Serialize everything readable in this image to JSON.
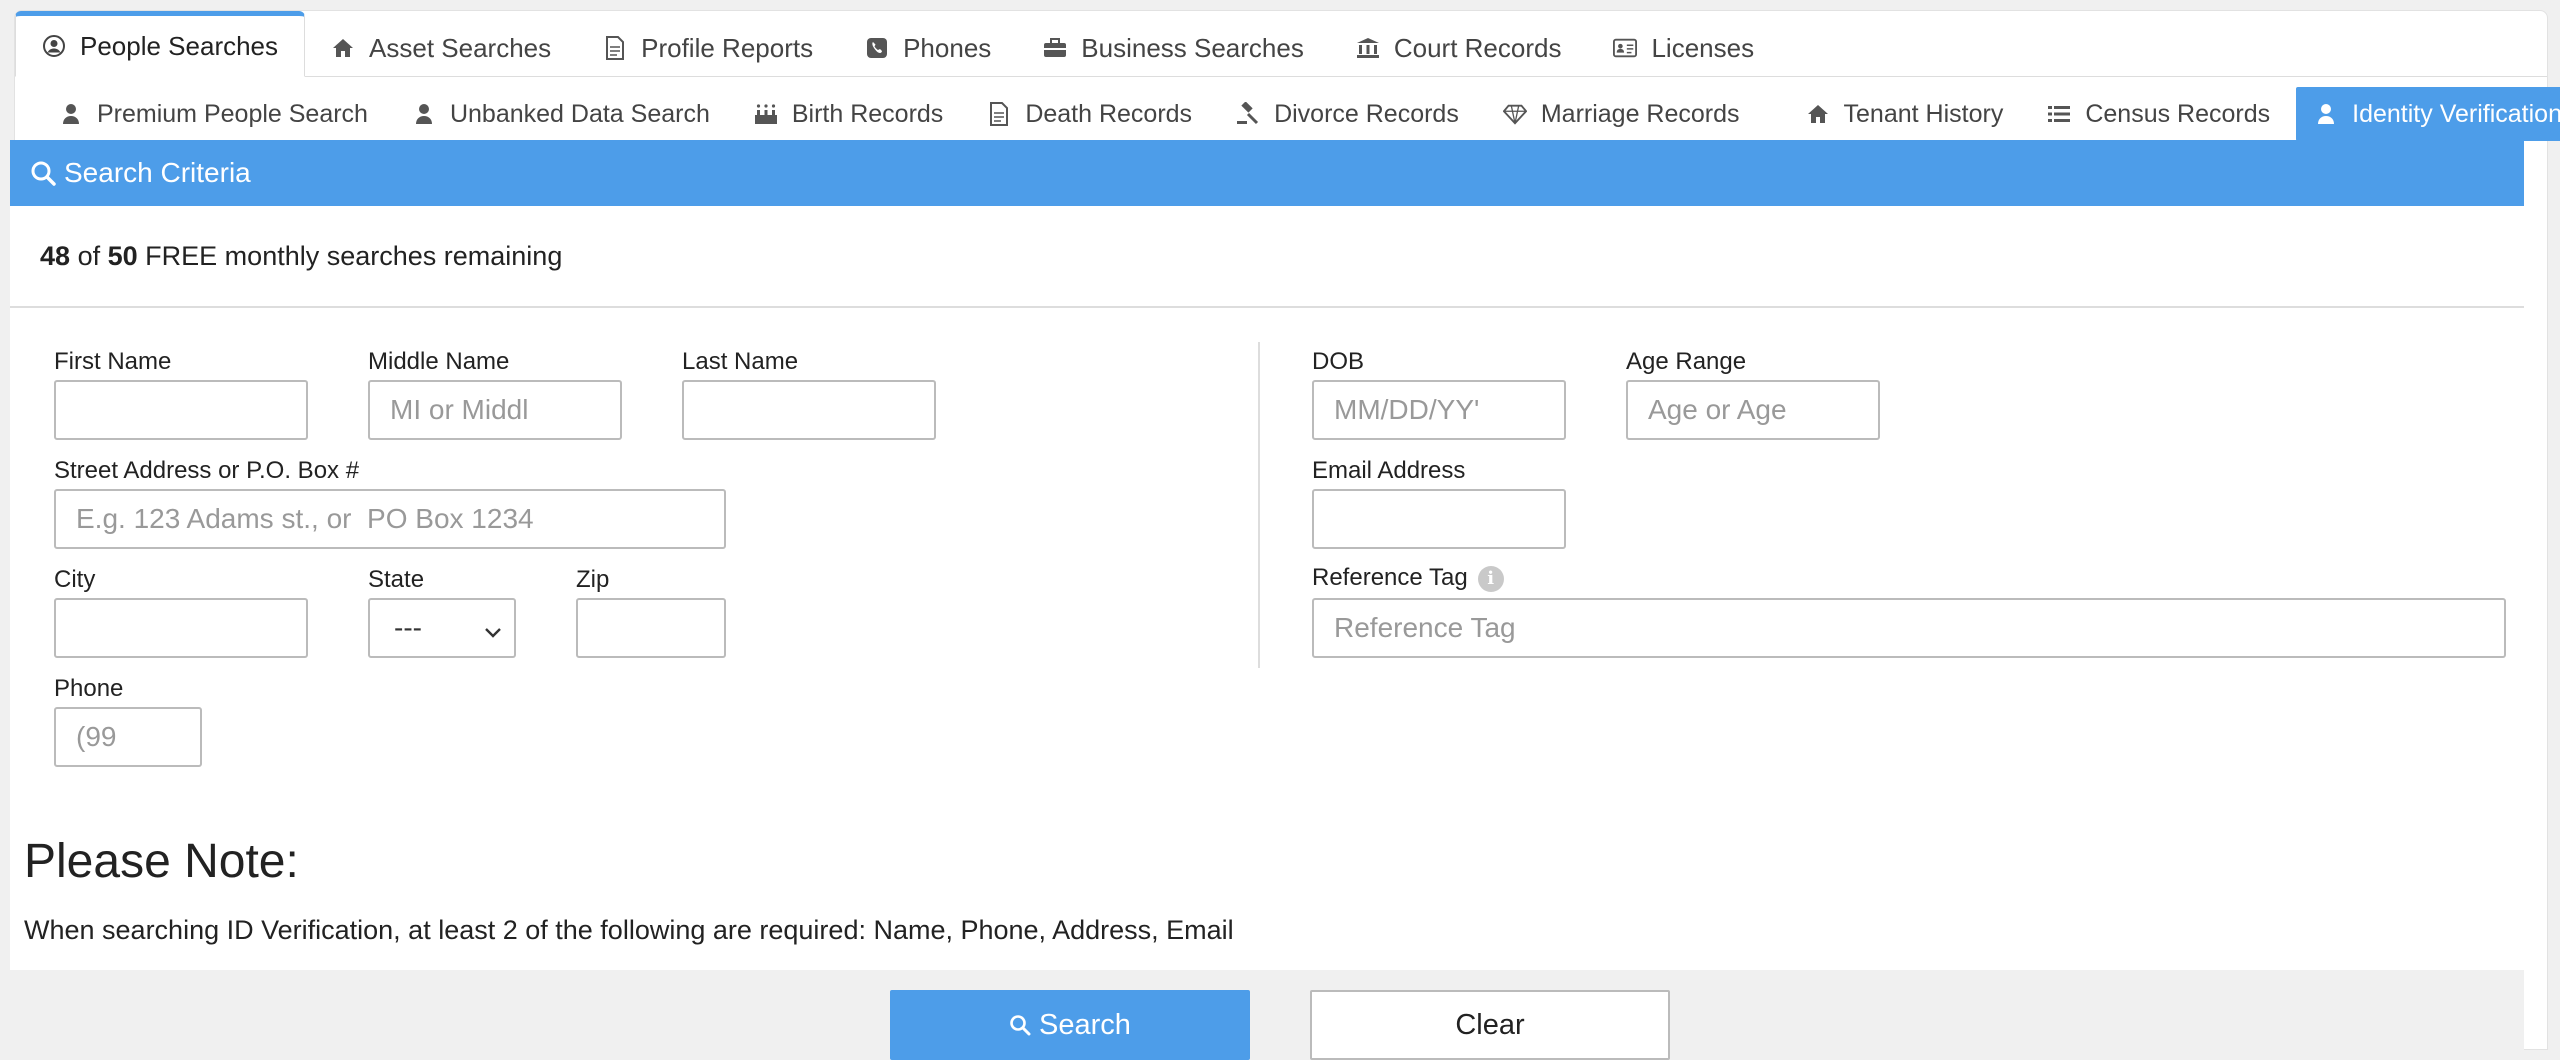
{
  "main_tabs": [
    {
      "label": "People Searches",
      "icon": "user-circle-icon",
      "active": true
    },
    {
      "label": "Asset Searches",
      "icon": "home-icon"
    },
    {
      "label": "Profile Reports",
      "icon": "document-icon"
    },
    {
      "label": "Phones",
      "icon": "phone-icon"
    },
    {
      "label": "Business Searches",
      "icon": "briefcase-icon"
    },
    {
      "label": "Court Records",
      "icon": "courthouse-icon"
    },
    {
      "label": "Licenses",
      "icon": "id-card-icon"
    }
  ],
  "sub_tabs": [
    {
      "label": "Premium People Search",
      "icon": "user-icon"
    },
    {
      "label": "Unbanked Data Search",
      "icon": "user-icon"
    },
    {
      "label": "Birth Records",
      "icon": "birthday-cake-icon"
    },
    {
      "label": "Death Records",
      "icon": "document-icon"
    },
    {
      "label": "Divorce Records",
      "icon": "gavel-icon"
    },
    {
      "label": "Marriage Records",
      "icon": "diamond-icon"
    },
    {
      "label": "Tenant History",
      "icon": "home-icon"
    },
    {
      "label": "Census Records",
      "icon": "list-icon"
    },
    {
      "label": "Identity Verification",
      "icon": "user-icon",
      "active": true
    }
  ],
  "panel": {
    "title": "Search Criteria",
    "remaining_used": "48",
    "remaining_of": "of",
    "remaining_total": "50",
    "remaining_suffix": "FREE monthly searches remaining"
  },
  "form": {
    "first_name": {
      "label": "First Name",
      "placeholder": ""
    },
    "middle_name": {
      "label": "Middle Name",
      "placeholder": "MI or Middl"
    },
    "last_name": {
      "label": "Last Name",
      "placeholder": ""
    },
    "street": {
      "label": "Street Address or P.O. Box #",
      "placeholder": "E.g. 123 Adams st., or  PO Box 1234"
    },
    "city": {
      "label": "City",
      "placeholder": ""
    },
    "state": {
      "label": "State",
      "value": "---"
    },
    "zip": {
      "label": "Zip",
      "placeholder": ""
    },
    "phone": {
      "label": "Phone",
      "placeholder": "(99"
    },
    "dob": {
      "label": "DOB",
      "placeholder": "MM/DD/YY'"
    },
    "age_range": {
      "label": "Age Range",
      "placeholder": "Age or Age"
    },
    "email": {
      "label": "Email Address",
      "placeholder": ""
    },
    "reference_tag": {
      "label": "Reference Tag",
      "placeholder": "Reference Tag",
      "info_icon": "i"
    }
  },
  "note": {
    "title": "Please Note:",
    "text": "When searching ID Verification, at least 2 of the following are required: Name, Phone, Address, Email"
  },
  "buttons": {
    "search": "Search",
    "clear": "Clear"
  },
  "colors": {
    "accent": "#4d9de9",
    "border": "#bbbbbb",
    "background": "#f0f0f0"
  }
}
